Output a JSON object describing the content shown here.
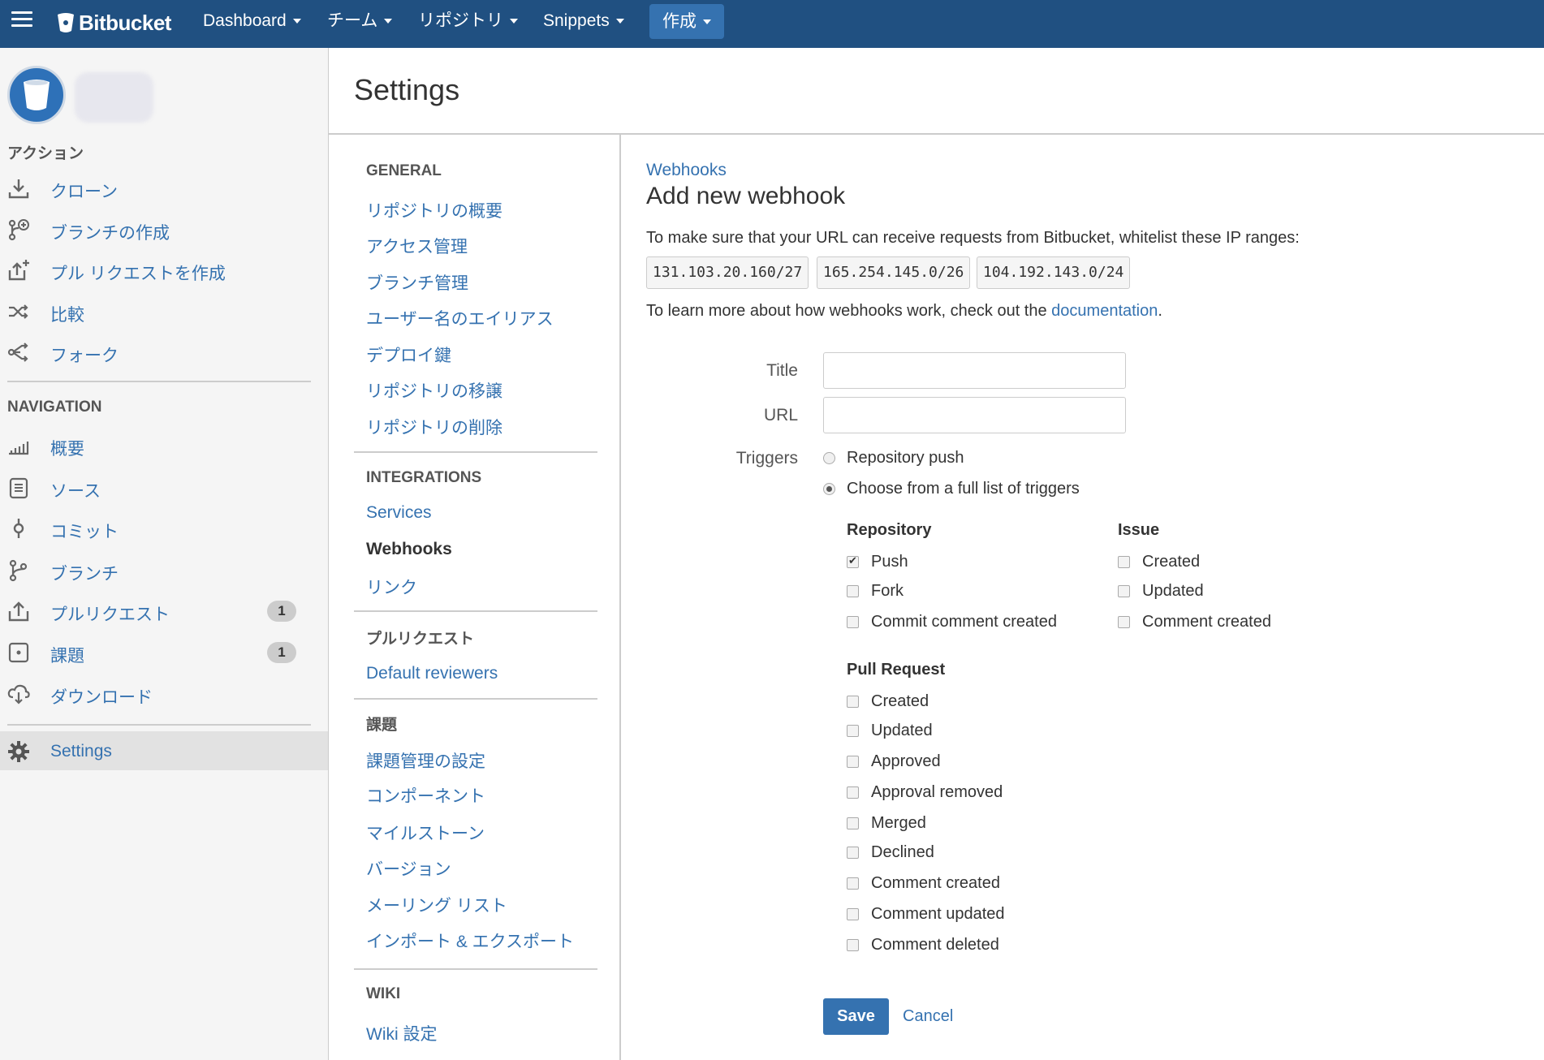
{
  "topbar": {
    "brand": "Bitbucket",
    "nav": [
      {
        "label": "Dashboard"
      },
      {
        "label": "チーム"
      },
      {
        "label": "リポジトリ"
      },
      {
        "label": "Snippets"
      }
    ],
    "create_label": "作成"
  },
  "sidebar": {
    "actions_heading": "アクション",
    "actions": [
      {
        "label": "クローン",
        "icon": "download-icon"
      },
      {
        "label": "ブランチの作成",
        "icon": "branch-add-icon"
      },
      {
        "label": "プル リクエストを作成",
        "icon": "pull-request-add-icon"
      },
      {
        "label": "比較",
        "icon": "compare-icon"
      },
      {
        "label": "フォーク",
        "icon": "fork-icon"
      }
    ],
    "navigation_heading": "NAVIGATION",
    "navigation": [
      {
        "label": "概要",
        "icon": "bar-chart-icon"
      },
      {
        "label": "ソース",
        "icon": "file-icon"
      },
      {
        "label": "コミット",
        "icon": "commit-icon"
      },
      {
        "label": "ブランチ",
        "icon": "branch-icon"
      },
      {
        "label": "プルリクエスト",
        "icon": "pull-request-icon",
        "badge": "1"
      },
      {
        "label": "課題",
        "icon": "issue-icon",
        "badge": "1"
      },
      {
        "label": "ダウンロード",
        "icon": "cloud-download-icon"
      }
    ],
    "settings_label": "Settings"
  },
  "page": {
    "title": "Settings"
  },
  "settings_nav": {
    "general_heading": "GENERAL",
    "general": [
      "リポジトリの概要",
      "アクセス管理",
      "ブランチ管理",
      "ユーザー名のエイリアス",
      "デプロイ鍵",
      "リポジトリの移譲",
      "リポジトリの削除"
    ],
    "integrations_heading": "INTEGRATIONS",
    "integrations": [
      "Services",
      "Webhooks",
      "リンク"
    ],
    "pr_heading": "プルリクエスト",
    "pr": [
      "Default reviewers"
    ],
    "issues_heading": "課題",
    "issues": [
      "課題管理の設定",
      "コンポーネント",
      "マイルストーン",
      "バージョン",
      "メーリング リスト",
      "インポート & エクスポート"
    ],
    "wiki_heading": "WIKI",
    "wiki": [
      "Wiki 設定"
    ]
  },
  "main": {
    "breadcrumb": "Webhooks",
    "heading": "Add new webhook",
    "whitelist_text": "To make sure that your URL can receive requests from Bitbucket, whitelist these IP ranges:",
    "ip_ranges": [
      "131.103.20.160/27",
      "165.254.145.0/26",
      "104.192.143.0/24"
    ],
    "learn_prefix": "To learn more about how webhooks work, check out the ",
    "learn_link": "documentation",
    "learn_suffix": ".",
    "title_label": "Title",
    "title_value": "",
    "url_label": "URL",
    "url_value": "",
    "triggers_label": "Triggers",
    "trigger_options": [
      {
        "label": "Repository push",
        "selected": false
      },
      {
        "label": "Choose from a full list of triggers",
        "selected": true
      }
    ],
    "repository_heading": "Repository",
    "repository_triggers": [
      {
        "label": "Push",
        "checked": true
      },
      {
        "label": "Fork",
        "checked": false
      },
      {
        "label": "Commit comment created",
        "checked": false
      }
    ],
    "issue_heading": "Issue",
    "issue_triggers": [
      {
        "label": "Created",
        "checked": false
      },
      {
        "label": "Updated",
        "checked": false
      },
      {
        "label": "Comment created",
        "checked": false
      }
    ],
    "pull_request_heading": "Pull Request",
    "pull_request_triggers": [
      {
        "label": "Created",
        "checked": false
      },
      {
        "label": "Updated",
        "checked": false
      },
      {
        "label": "Approved",
        "checked": false
      },
      {
        "label": "Approval removed",
        "checked": false
      },
      {
        "label": "Merged",
        "checked": false
      },
      {
        "label": "Declined",
        "checked": false
      },
      {
        "label": "Comment created",
        "checked": false
      },
      {
        "label": "Comment updated",
        "checked": false
      },
      {
        "label": "Comment deleted",
        "checked": false
      }
    ],
    "save_label": "Save",
    "cancel_label": "Cancel"
  },
  "colors": {
    "topbar": "#205081",
    "link": "#3572b0",
    "button": "#3572b0"
  }
}
